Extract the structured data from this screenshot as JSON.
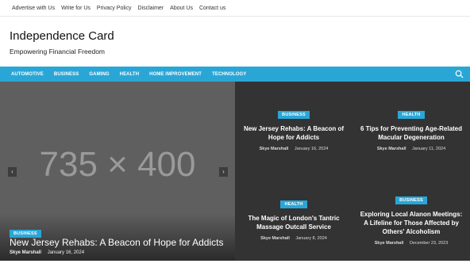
{
  "topbar": {
    "links": [
      "Advertise with Us",
      "Write for Us",
      "Privacy Policy",
      "Disclaimer",
      "About Us",
      "Contact us"
    ]
  },
  "site": {
    "title": "Independence Card",
    "tagline": "Empowering Financial Freedom"
  },
  "nav": {
    "items": [
      "AUTOMOTIVE",
      "BUSINESS",
      "GAMING",
      "HEALTH",
      "HOME IMPROVEMENT",
      "TECHNOLOGY"
    ],
    "search_icon": "search-icon"
  },
  "hero": {
    "placeholder": "735 × 400",
    "category": "BUSINESS",
    "title": "New Jersey Rehabs: A Beacon of Hope for Addicts",
    "author": "Skye Marshall",
    "date": "January 16, 2024",
    "prev": "‹",
    "next": "›"
  },
  "cards": [
    {
      "category": "BUSINESS",
      "title": "New Jersey Rehabs: A Beacon of Hope for Addicts",
      "author": "Skye Marshall",
      "date": "January 16, 2024"
    },
    {
      "category": "HEALTH",
      "title": "6 Tips for Preventing Age-Related Macular Degeneration",
      "author": "Skye Marshall",
      "date": "January 11, 2024"
    },
    {
      "category": "HEALTH",
      "title": "The Magic of London's Tantric Massage Outcall Service",
      "author": "Skye Marshall",
      "date": "January 8, 2024"
    },
    {
      "category": "BUSINESS",
      "title": "Exploring Local Alanon Meetings: A Lifeline for Those Affected by Others' Alcoholism",
      "author": "Skye Marshall",
      "date": "December 23, 2023"
    }
  ],
  "colors": {
    "accent": "#2aa6d6",
    "dark": "#333333"
  }
}
